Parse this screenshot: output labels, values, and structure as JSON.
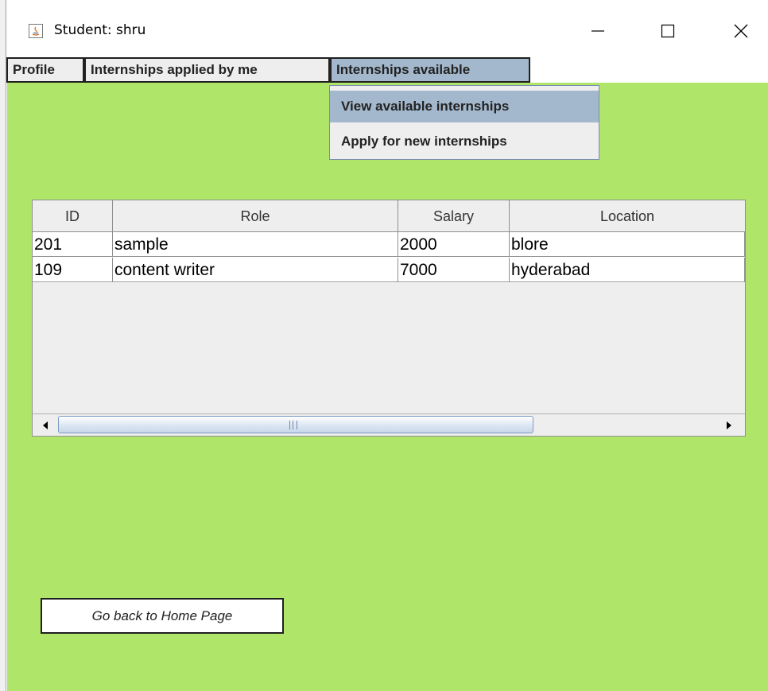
{
  "window": {
    "title": "Student: shru",
    "icon": "java-app-icon",
    "controls": [
      "minimize-icon",
      "maximize-icon",
      "close-icon"
    ]
  },
  "menubar": {
    "items": [
      {
        "label": "Profile"
      },
      {
        "label": "Internships applied by me"
      },
      {
        "label": "Internships available"
      }
    ],
    "active_menu": "Internships available"
  },
  "dropdown": {
    "items": [
      {
        "label": "View available internships"
      },
      {
        "label": "Apply for new internships"
      }
    ],
    "highlighted": "View available internships"
  },
  "table": {
    "columns": [
      "ID",
      "Role",
      "Salary",
      "Location"
    ],
    "rows": [
      [
        "201",
        "sample",
        "2000",
        "blore"
      ],
      [
        "109",
        "content writer",
        "7000",
        "hyderabad"
      ]
    ]
  },
  "buttons": {
    "home": "Go back to Home Page"
  },
  "colors": {
    "background": "#afe66a",
    "menu_active": "#a3b8cc",
    "menu_bg": "#eeeeee"
  }
}
